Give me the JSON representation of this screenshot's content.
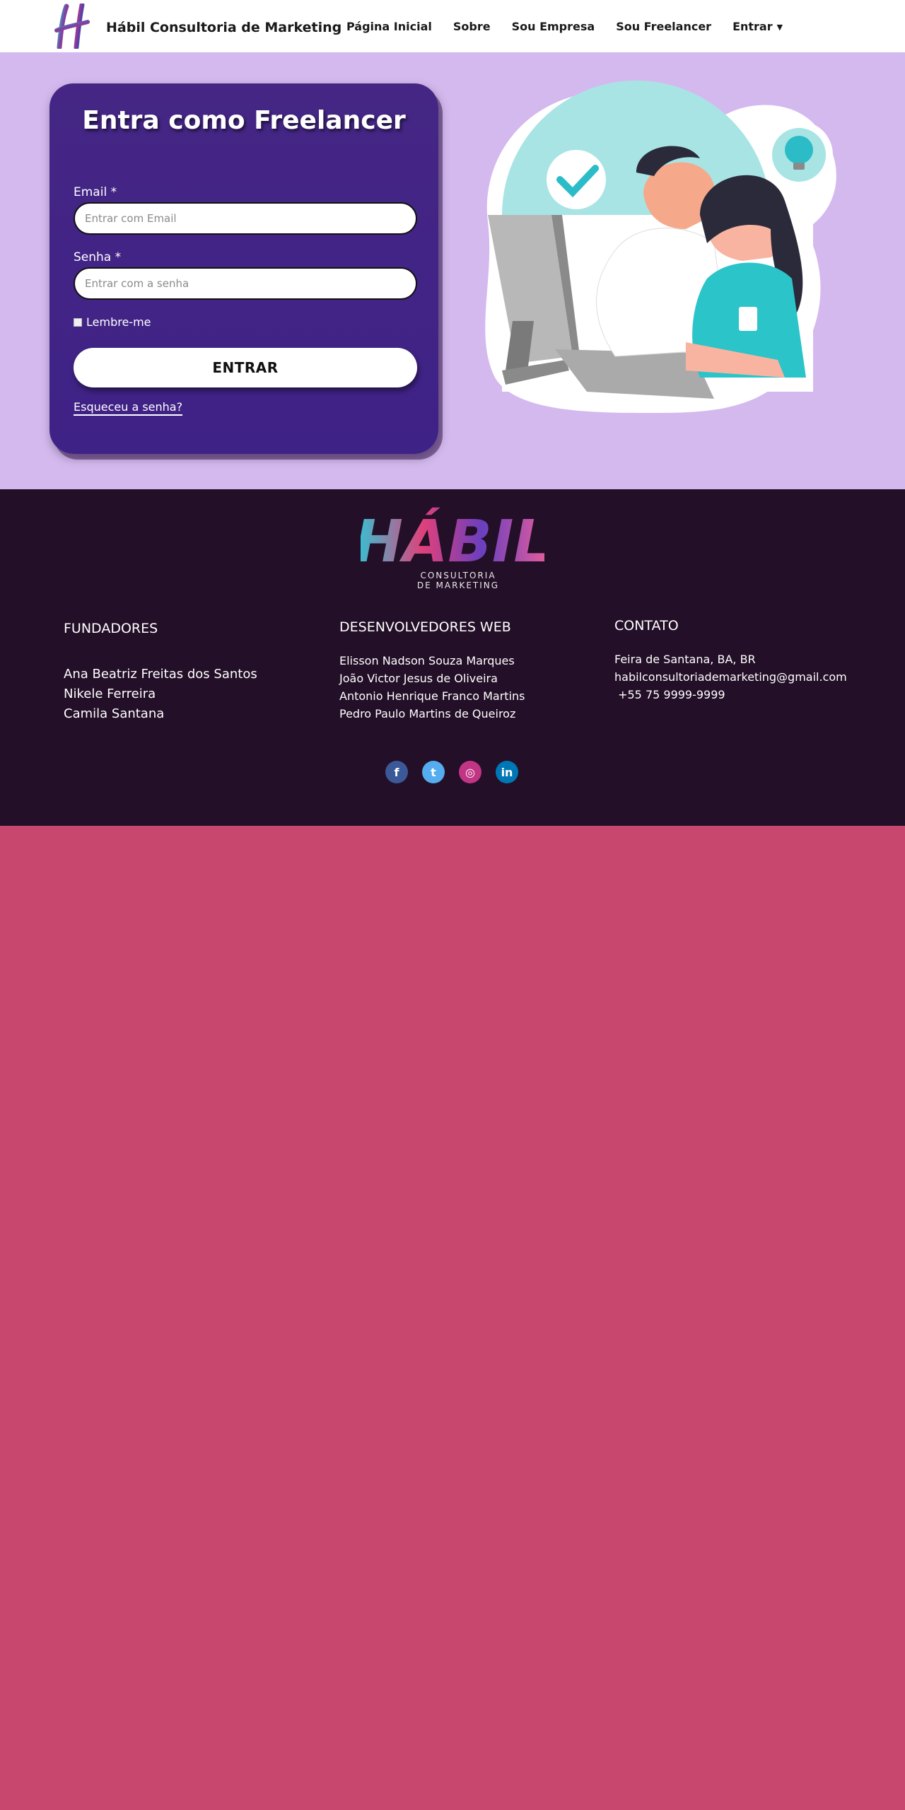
{
  "navbar": {
    "brand_name": "Hábil Consultoria de Marketing",
    "links": [
      "Página Inicial",
      "Sobre",
      "Sou Empresa",
      "Sou Freelancer",
      "Entrar"
    ]
  },
  "login": {
    "title": "Entra como Freelancer",
    "email_label": "Email *",
    "email_placeholder": "Entrar com Email",
    "password_label": "Senha *",
    "password_placeholder": "Entrar com a senha",
    "remember_label": "Lembre-me",
    "submit_label": "ENTRAR",
    "forgot_label": "Esqueceu a senha?"
  },
  "footer": {
    "logo_text": "HÁBIL",
    "logo_sub1": "CONSULTORIA",
    "logo_sub2": "DE MARKETING",
    "founders": {
      "title": "FUNDADORES",
      "names": [
        "Ana Beatriz Freitas dos Santos",
        "Nikele Ferreira",
        "Camila Santana"
      ]
    },
    "developers": {
      "title": "DESENVOLVEDORES WEB",
      "names": [
        "Elisson Nadson Souza Marques",
        "João Victor Jesus de Oliveira",
        "Antonio Henrique Franco Martins",
        "Pedro Paulo Martins de Queiroz"
      ]
    },
    "contact": {
      "title": "CONTATO",
      "lines": [
        "Feira de Santana, BA, BR",
        "habilconsultoriademarketing@gmail.com",
        " +55 75 9999-9999"
      ]
    },
    "social": [
      {
        "icon": "facebook-icon",
        "glyph": "f",
        "color": "#3b5998"
      },
      {
        "icon": "twitter-icon",
        "glyph": "t",
        "color": "#55acee"
      },
      {
        "icon": "instagram-icon",
        "glyph": "◎",
        "color": "#c13584"
      },
      {
        "icon": "linkedin-icon",
        "glyph": "in",
        "color": "#0077b5"
      }
    ]
  },
  "colors": {
    "hero_bg": "#d4b9ef",
    "card_bg": "#452685",
    "footer_bg": "#230f27",
    "page_bg": "#c7476e"
  }
}
